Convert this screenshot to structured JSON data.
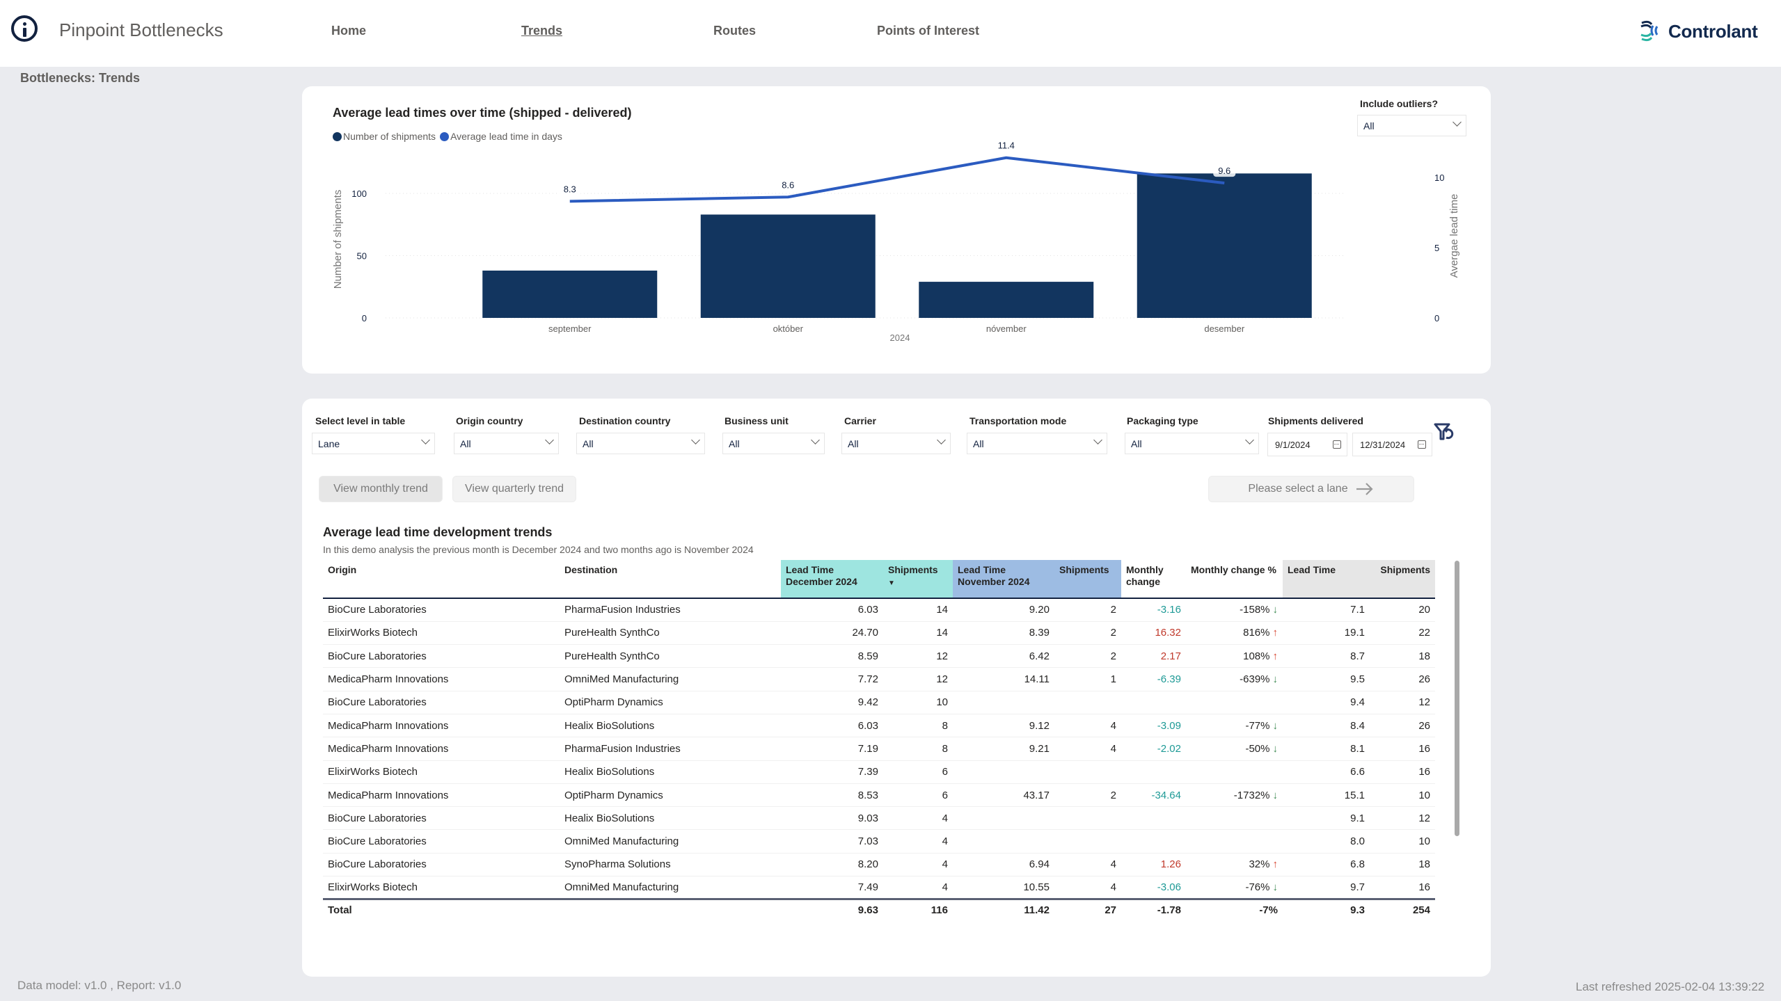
{
  "header": {
    "app_title": "Pinpoint Bottlenecks",
    "nav": [
      {
        "label": "Home",
        "active": false
      },
      {
        "label": "Trends",
        "active": true
      },
      {
        "label": "Routes",
        "active": false
      },
      {
        "label": "Points of Interest",
        "active": false
      }
    ],
    "logo_text": "Controlant",
    "info_icon": "info-circle-icon"
  },
  "breadcrumb": "Bottlenecks: Trends",
  "outliers": {
    "label": "Include outliers?",
    "value": "All"
  },
  "chart_data": {
    "type": "bar",
    "title": "Average lead times over time (shipped - delivered)",
    "legend": [
      {
        "name": "Number of shipments",
        "color": "#12355f"
      },
      {
        "name": "Average lead time in days",
        "color": "#2b5bc0"
      }
    ],
    "legend_position": "top-left",
    "categories": [
      "september",
      "október",
      "nóvember",
      "desember"
    ],
    "xlabel": "2024",
    "series": [
      {
        "name": "Number of shipments",
        "type": "bar",
        "axis": "left",
        "color": "#12355f",
        "values": [
          38,
          83,
          29,
          116
        ]
      },
      {
        "name": "Average lead time in days",
        "type": "line",
        "axis": "right",
        "color": "#2b5bc0",
        "values": [
          8.3,
          8.6,
          11.4,
          9.6
        ]
      }
    ],
    "ylabel_left": "Number of shipments",
    "ylabel_right": "Avergae lead time",
    "yticks_left": [
      0,
      50,
      100
    ],
    "yticks_right": [
      0,
      5,
      10
    ],
    "ylim_left": [
      0,
      100
    ],
    "ylim_right": [
      0,
      10
    ],
    "grid": true
  },
  "filters": [
    {
      "label": "Select level in table",
      "value": "Lane"
    },
    {
      "label": "Origin country",
      "value": "All"
    },
    {
      "label": "Destination country",
      "value": "All"
    },
    {
      "label": "Business unit",
      "value": "All"
    },
    {
      "label": "Carrier",
      "value": "All"
    },
    {
      "label": "Transportation mode",
      "value": "All"
    },
    {
      "label": "Packaging type",
      "value": "All"
    }
  ],
  "date_filter": {
    "label": "Shipments delivered",
    "start": "9/1/2024",
    "end": "12/31/2024"
  },
  "buttons": {
    "monthly": "View monthly trend",
    "quarterly": "View quarterly trend",
    "select_lane": "Please select a lane"
  },
  "table": {
    "title": "Average lead time development trends",
    "subtitle": "In this demo analysis the previous month is December 2024 and two months ago is November 2024",
    "columns": [
      "Origin",
      "Destination",
      "Lead Time December 2024",
      "Shipments",
      "Lead Time November 2024",
      "Shipments",
      "Monthly change",
      "Monthly change %",
      "Lead Time",
      "Shipments"
    ],
    "sorted_column": "Shipments (December 2024)",
    "rows": [
      {
        "origin": "BioCure Laboratories",
        "destination": "PharmaFusion Industries",
        "lt_dec": "6.03",
        "sh_dec": "14",
        "lt_nov": "9.20",
        "sh_nov": "2",
        "change": "-3.16",
        "change_pct": "-158%",
        "trend": "down",
        "lt_total": "7.1",
        "sh_total": "20"
      },
      {
        "origin": "ElixirWorks Biotech",
        "destination": "PureHealth SynthCo",
        "lt_dec": "24.70",
        "sh_dec": "14",
        "lt_nov": "8.39",
        "sh_nov": "2",
        "change": "16.32",
        "change_pct": "816%",
        "trend": "up",
        "lt_total": "19.1",
        "sh_total": "22"
      },
      {
        "origin": "BioCure Laboratories",
        "destination": "PureHealth SynthCo",
        "lt_dec": "8.59",
        "sh_dec": "12",
        "lt_nov": "6.42",
        "sh_nov": "2",
        "change": "2.17",
        "change_pct": "108%",
        "trend": "up",
        "lt_total": "8.7",
        "sh_total": "18"
      },
      {
        "origin": "MedicaPharm Innovations",
        "destination": "OmniMed Manufacturing",
        "lt_dec": "7.72",
        "sh_dec": "12",
        "lt_nov": "14.11",
        "sh_nov": "1",
        "change": "-6.39",
        "change_pct": "-639%",
        "trend": "down",
        "lt_total": "9.5",
        "sh_total": "26"
      },
      {
        "origin": "BioCure Laboratories",
        "destination": "OptiPharm Dynamics",
        "lt_dec": "9.42",
        "sh_dec": "10",
        "lt_nov": "",
        "sh_nov": "",
        "change": "",
        "change_pct": "",
        "trend": "",
        "lt_total": "9.4",
        "sh_total": "12"
      },
      {
        "origin": "MedicaPharm Innovations",
        "destination": "Healix BioSolutions",
        "lt_dec": "6.03",
        "sh_dec": "8",
        "lt_nov": "9.12",
        "sh_nov": "4",
        "change": "-3.09",
        "change_pct": "-77%",
        "trend": "down",
        "lt_total": "8.4",
        "sh_total": "26"
      },
      {
        "origin": "MedicaPharm Innovations",
        "destination": "PharmaFusion Industries",
        "lt_dec": "7.19",
        "sh_dec": "8",
        "lt_nov": "9.21",
        "sh_nov": "4",
        "change": "-2.02",
        "change_pct": "-50%",
        "trend": "down",
        "lt_total": "8.1",
        "sh_total": "16"
      },
      {
        "origin": "ElixirWorks Biotech",
        "destination": "Healix BioSolutions",
        "lt_dec": "7.39",
        "sh_dec": "6",
        "lt_nov": "",
        "sh_nov": "",
        "change": "",
        "change_pct": "",
        "trend": "",
        "lt_total": "6.6",
        "sh_total": "16"
      },
      {
        "origin": "MedicaPharm Innovations",
        "destination": "OptiPharm Dynamics",
        "lt_dec": "8.53",
        "sh_dec": "6",
        "lt_nov": "43.17",
        "sh_nov": "2",
        "change": "-34.64",
        "change_pct": "-1732%",
        "trend": "down",
        "lt_total": "15.1",
        "sh_total": "10"
      },
      {
        "origin": "BioCure Laboratories",
        "destination": "Healix BioSolutions",
        "lt_dec": "9.03",
        "sh_dec": "4",
        "lt_nov": "",
        "sh_nov": "",
        "change": "",
        "change_pct": "",
        "trend": "",
        "lt_total": "9.1",
        "sh_total": "12"
      },
      {
        "origin": "BioCure Laboratories",
        "destination": "OmniMed Manufacturing",
        "lt_dec": "7.03",
        "sh_dec": "4",
        "lt_nov": "",
        "sh_nov": "",
        "change": "",
        "change_pct": "",
        "trend": "",
        "lt_total": "8.0",
        "sh_total": "10"
      },
      {
        "origin": "BioCure Laboratories",
        "destination": "SynoPharma Solutions",
        "lt_dec": "8.20",
        "sh_dec": "4",
        "lt_nov": "6.94",
        "sh_nov": "4",
        "change": "1.26",
        "change_pct": "32%",
        "trend": "up",
        "lt_total": "6.8",
        "sh_total": "18"
      },
      {
        "origin": "ElixirWorks Biotech",
        "destination": "OmniMed Manufacturing",
        "lt_dec": "7.49",
        "sh_dec": "4",
        "lt_nov": "10.55",
        "sh_nov": "4",
        "change": "-3.06",
        "change_pct": "-76%",
        "trend": "down",
        "lt_total": "9.7",
        "sh_total": "16"
      }
    ],
    "total": {
      "label": "Total",
      "lt_dec": "9.63",
      "sh_dec": "116",
      "lt_nov": "11.42",
      "sh_nov": "27",
      "change": "-1.78",
      "change_pct": "-7%",
      "lt_total": "9.3",
      "sh_total": "254"
    }
  },
  "footer": {
    "version": "Data model: v1.0 , Report: v1.0",
    "last_refreshed": "Last refreshed 2025-02-04 13:39:22"
  }
}
